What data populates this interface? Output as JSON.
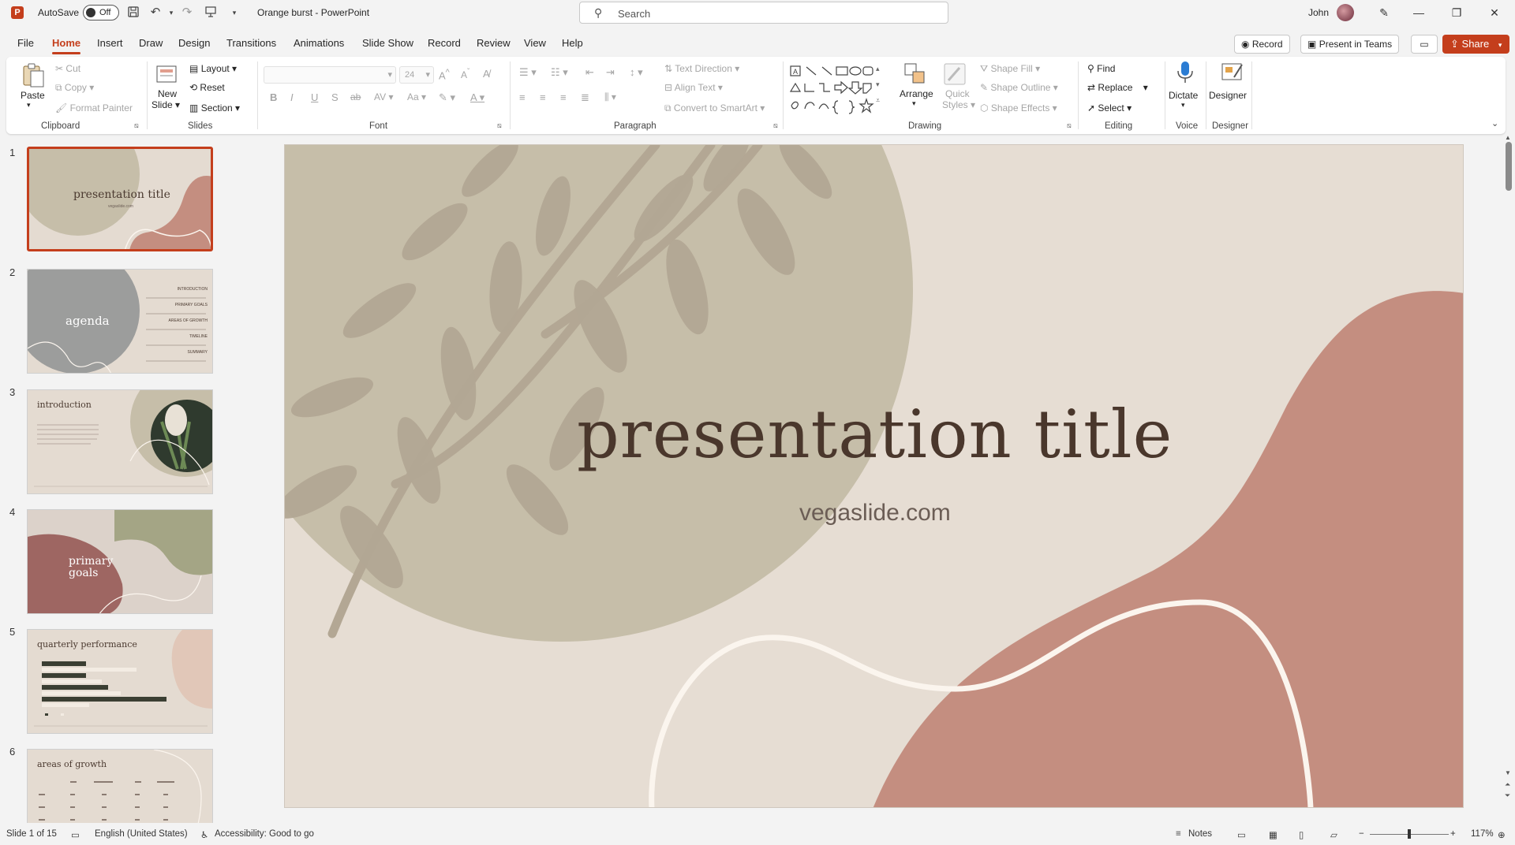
{
  "titlebar": {
    "autosave_label": "AutoSave",
    "autosave_state": "Off",
    "doc_title": "Orange burst  -  PowerPoint",
    "search_placeholder": "Search",
    "user_name": "John"
  },
  "menu": {
    "tabs": [
      "File",
      "Home",
      "Insert",
      "Draw",
      "Design",
      "Transitions",
      "Animations",
      "Slide Show",
      "Record",
      "Review",
      "View",
      "Help"
    ],
    "record_btn": "Record",
    "teams_btn": "Present in Teams",
    "share_btn": "Share"
  },
  "ribbon": {
    "clipboard": {
      "paste": "Paste",
      "cut": "Cut",
      "copy": "Copy",
      "format_painter": "Format Painter",
      "label": "Clipboard"
    },
    "slides": {
      "new_slide": "New",
      "new_slide2": "Slide",
      "layout": "Layout",
      "reset": "Reset",
      "section": "Section",
      "label": "Slides"
    },
    "font": {
      "size": "24",
      "bold": "B",
      "italic": "I",
      "underline": "U",
      "shadow": "S",
      "strike": "ab",
      "spacing": "AV",
      "case": "Aa",
      "label": "Font"
    },
    "paragraph": {
      "text_direction": "Text Direction",
      "align_text": "Align Text",
      "smartart": "Convert to SmartArt",
      "label": "Paragraph"
    },
    "drawing": {
      "arrange": "Arrange",
      "quick_styles": "Quick",
      "quick_styles2": "Styles",
      "shape_fill": "Shape Fill",
      "shape_outline": "Shape Outline",
      "shape_effects": "Shape Effects",
      "label": "Drawing"
    },
    "editing": {
      "find": "Find",
      "replace": "Replace",
      "select": "Select",
      "label": "Editing"
    },
    "voice": {
      "dictate": "Dictate",
      "label": "Voice"
    },
    "designer": {
      "designer": "Designer",
      "label": "Designer"
    }
  },
  "thumbnails": [
    {
      "num": "1",
      "title": "presentation title",
      "sub": "vegaslide.com"
    },
    {
      "num": "2",
      "title": "agenda",
      "items": [
        "INTRODUCTION",
        "PRIMARY GOALS",
        "AREAS OF GROWTH",
        "TIMELINE",
        "SUMMARY"
      ]
    },
    {
      "num": "3",
      "title": "introduction"
    },
    {
      "num": "4",
      "title": "primary",
      "title2": "goals"
    },
    {
      "num": "5",
      "title": "quarterly performance"
    },
    {
      "num": "6",
      "title": "areas of growth"
    }
  ],
  "slide": {
    "title": "presentation title",
    "subtitle": "vegaslide.com",
    "colors": {
      "background": "#e6ddd3",
      "sage": "#c6bea9",
      "leaf": "#b3a794",
      "terracotta": "#c48e80",
      "curve": "#fbf5ee",
      "title": "#4a372c"
    }
  },
  "status": {
    "slide_count": "Slide 1 of 15",
    "language": "English (United States)",
    "accessibility": "Accessibility: Good to go",
    "notes": "Notes",
    "zoom": "117%"
  },
  "accent_color": "#c43e1c"
}
